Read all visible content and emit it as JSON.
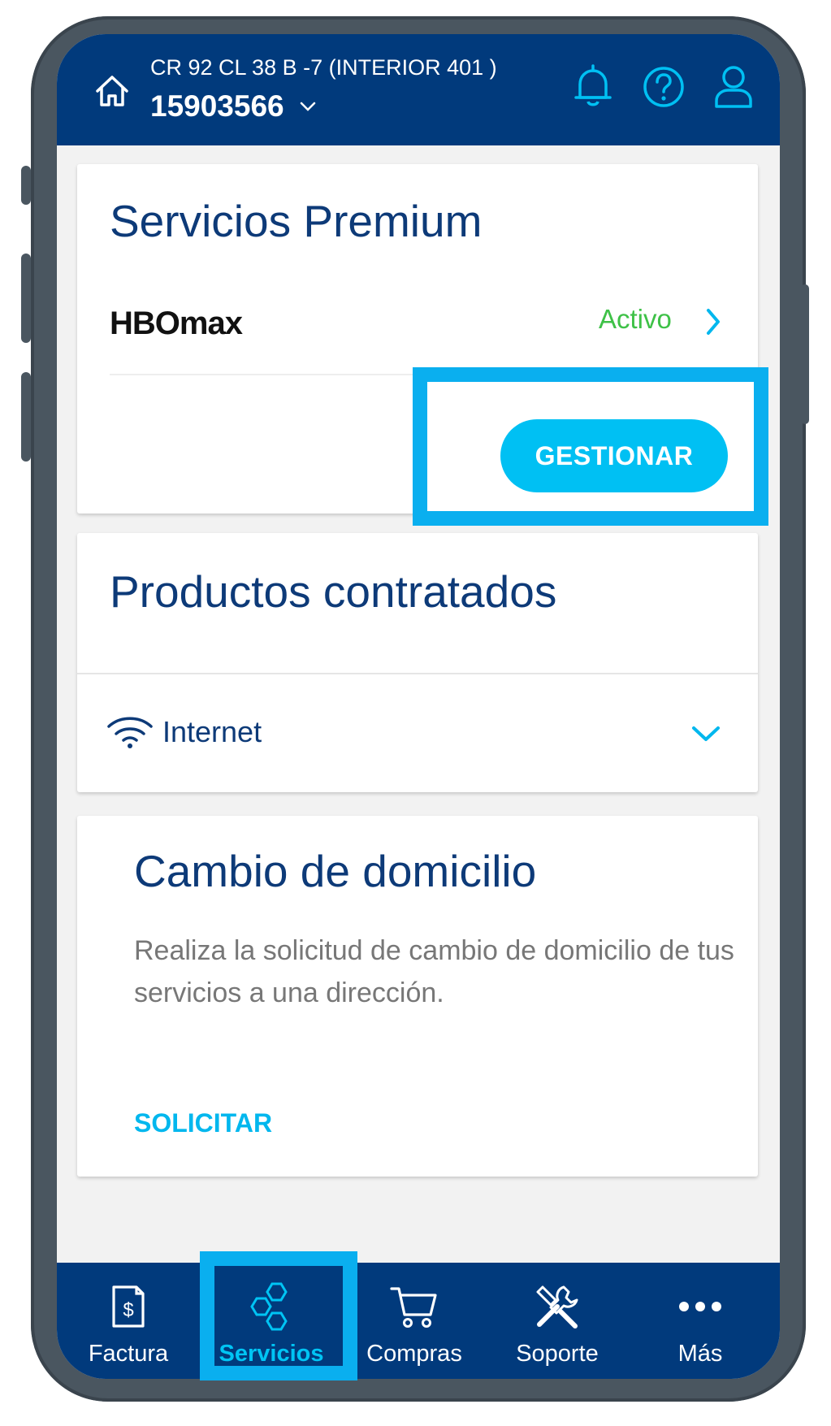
{
  "header": {
    "address": "CR 92 CL 38 B -7 (INTERIOR 401 )",
    "account_number": "15903566"
  },
  "premium": {
    "title": "Servicios Premium",
    "service_logo_text": "HBOmax",
    "status": "Activo",
    "manage_label": "GESTIONAR"
  },
  "products": {
    "title": "Productos contratados",
    "items": [
      {
        "label": "Internet"
      }
    ]
  },
  "domicilio": {
    "title": "Cambio de domicilio",
    "description": "Realiza la solicitud de cambio de domicilio de tus servicios a una dirección.",
    "action_label": "SOLICITAR"
  },
  "nav": {
    "items": [
      {
        "label": "Factura",
        "icon": "invoice-icon",
        "active": false
      },
      {
        "label": "Servicios",
        "icon": "hexagons-icon",
        "active": true
      },
      {
        "label": "Compras",
        "icon": "cart-icon",
        "active": false
      },
      {
        "label": "Soporte",
        "icon": "tools-icon",
        "active": false
      },
      {
        "label": "Más",
        "icon": "more-icon",
        "active": false
      }
    ]
  },
  "colors": {
    "header_bg": "#013a7c",
    "accent": "#00c0f3",
    "status_active": "#3ec147",
    "title_text": "#0d3a78",
    "highlight": "#0aafef"
  }
}
